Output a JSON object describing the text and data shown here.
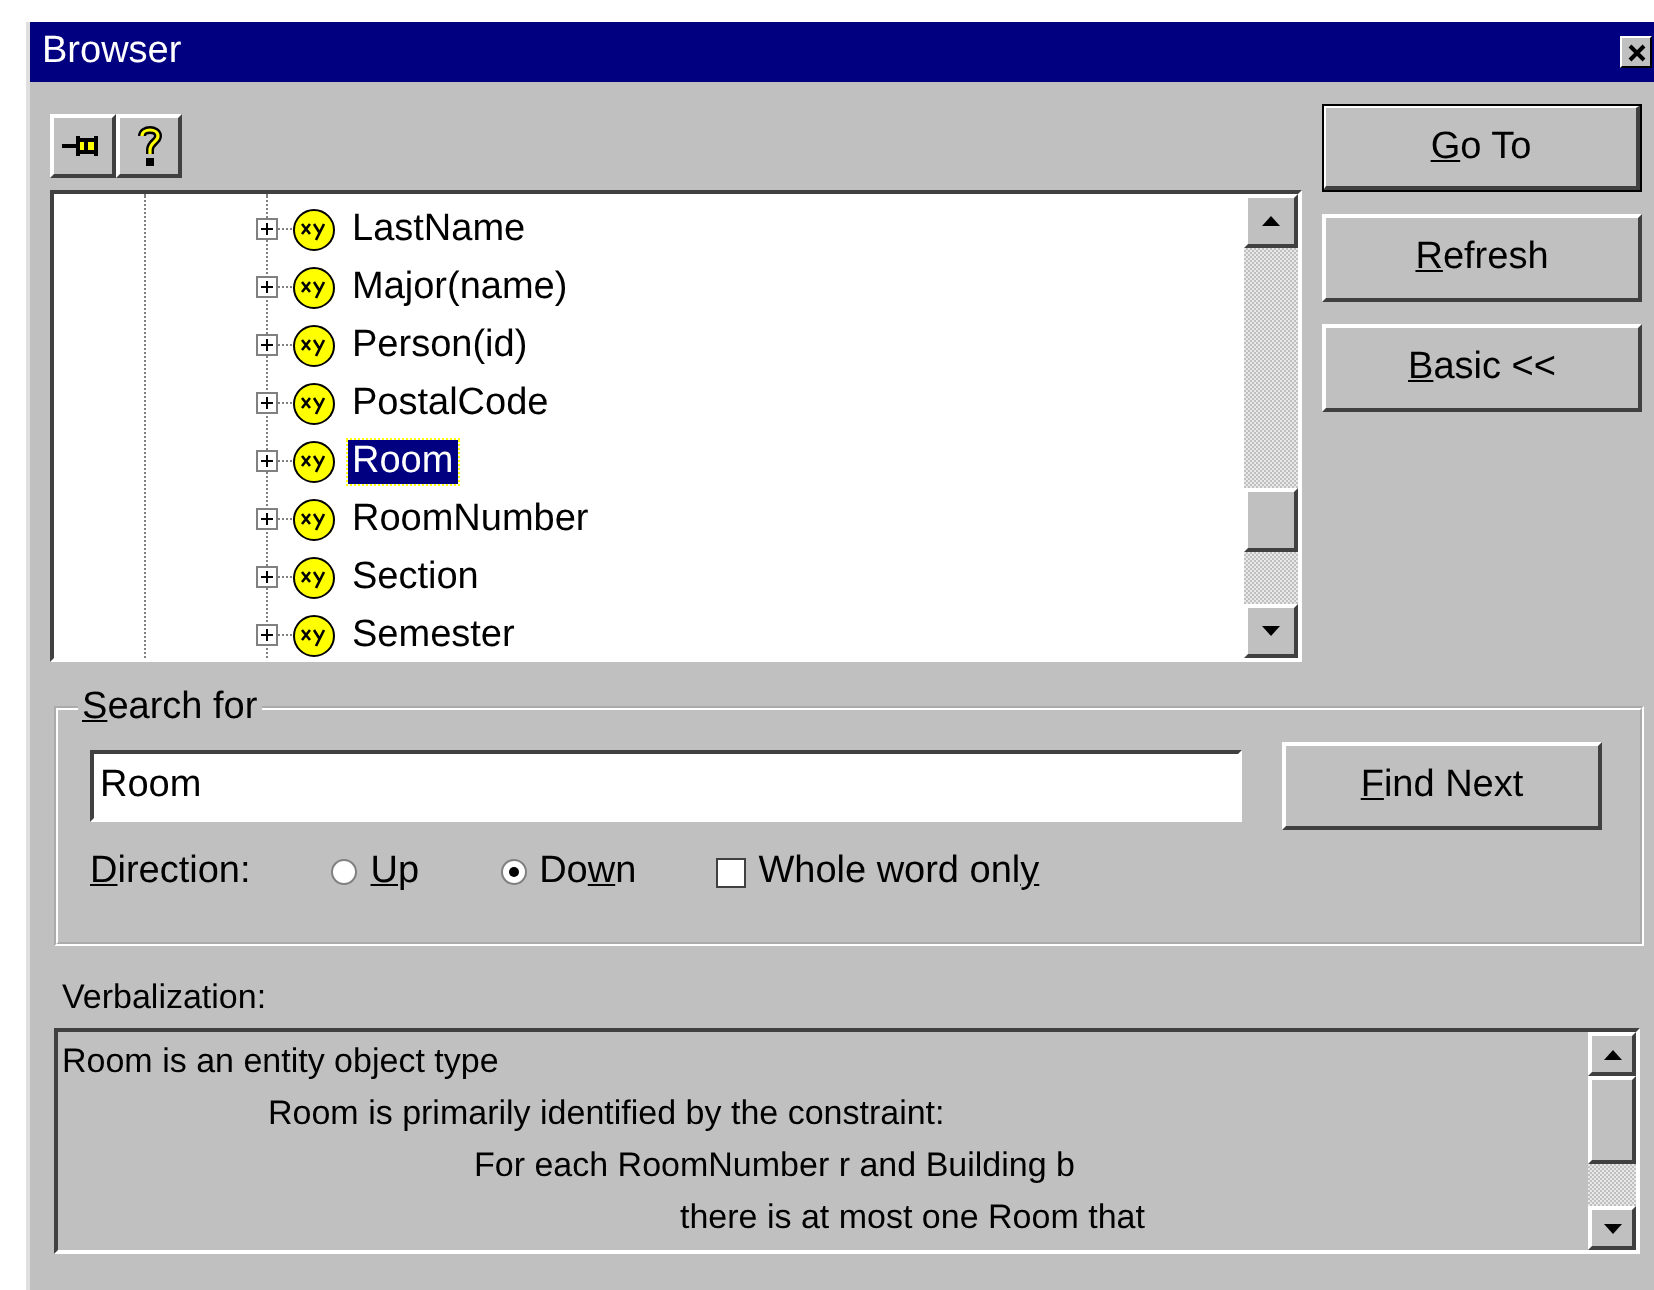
{
  "window": {
    "title": "Browser"
  },
  "toolbar": [
    {
      "kind": "pin"
    },
    {
      "kind": "help"
    }
  ],
  "tree": {
    "items": [
      {
        "label": "LastName",
        "expanded": false,
        "selected": false
      },
      {
        "label": "Major(name)",
        "expanded": false,
        "selected": false
      },
      {
        "label": "Person(id)",
        "expanded": false,
        "selected": false
      },
      {
        "label": "PostalCode",
        "expanded": false,
        "selected": false
      },
      {
        "label": "Room",
        "expanded": false,
        "selected": true
      },
      {
        "label": "RoomNumber",
        "expanded": false,
        "selected": false
      },
      {
        "label": "Section",
        "expanded": false,
        "selected": false
      },
      {
        "label": "Semester",
        "expanded": false,
        "selected": false
      }
    ]
  },
  "buttons": [
    {
      "key": "G",
      "post": "o To",
      "default": true
    },
    {
      "key": "R",
      "post": "efresh",
      "default": false
    },
    {
      "key": "B",
      "post": "asic <<",
      "default": false
    }
  ],
  "search": {
    "legend": {
      "key": "S",
      "post": "earch for"
    },
    "value": "Room",
    "find_button": {
      "key": "F",
      "post": "ind Next"
    },
    "direction_label": {
      "key": "D",
      "post": "irection:"
    },
    "directions": [
      {
        "key": "U",
        "post": "p",
        "selected": false
      },
      {
        "pre": "Do",
        "key": "w",
        "post": "n",
        "selected": true
      }
    ],
    "whole_word": {
      "pre": "Whole word onl",
      "key": "y",
      "checked": false
    }
  },
  "verbalization": {
    "label": "Verbalization:",
    "lines": [
      {
        "text": "Room is an entity object type",
        "children": [
          {
            "text": "Room is primarily identified by the constraint:",
            "children": [
              {
                "text": "For each RoomNumber r and Building b",
                "children": [
                  {
                    "text": "there is at most one Room that"
                  }
                ]
              }
            ]
          }
        ]
      }
    ]
  }
}
